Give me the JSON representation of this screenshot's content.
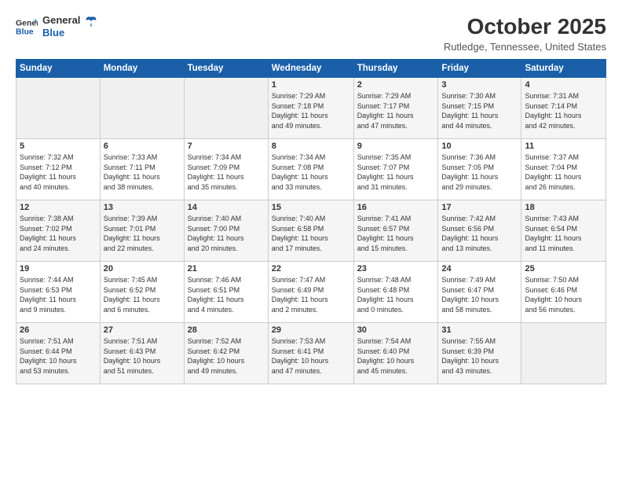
{
  "logo": {
    "line1": "General",
    "line2": "Blue"
  },
  "title": "October 2025",
  "location": "Rutledge, Tennessee, United States",
  "days_of_week": [
    "Sunday",
    "Monday",
    "Tuesday",
    "Wednesday",
    "Thursday",
    "Friday",
    "Saturday"
  ],
  "weeks": [
    [
      {
        "num": "",
        "info": ""
      },
      {
        "num": "",
        "info": ""
      },
      {
        "num": "",
        "info": ""
      },
      {
        "num": "1",
        "info": "Sunrise: 7:29 AM\nSunset: 7:18 PM\nDaylight: 11 hours\nand 49 minutes."
      },
      {
        "num": "2",
        "info": "Sunrise: 7:29 AM\nSunset: 7:17 PM\nDaylight: 11 hours\nand 47 minutes."
      },
      {
        "num": "3",
        "info": "Sunrise: 7:30 AM\nSunset: 7:15 PM\nDaylight: 11 hours\nand 44 minutes."
      },
      {
        "num": "4",
        "info": "Sunrise: 7:31 AM\nSunset: 7:14 PM\nDaylight: 11 hours\nand 42 minutes."
      }
    ],
    [
      {
        "num": "5",
        "info": "Sunrise: 7:32 AM\nSunset: 7:12 PM\nDaylight: 11 hours\nand 40 minutes."
      },
      {
        "num": "6",
        "info": "Sunrise: 7:33 AM\nSunset: 7:11 PM\nDaylight: 11 hours\nand 38 minutes."
      },
      {
        "num": "7",
        "info": "Sunrise: 7:34 AM\nSunset: 7:09 PM\nDaylight: 11 hours\nand 35 minutes."
      },
      {
        "num": "8",
        "info": "Sunrise: 7:34 AM\nSunset: 7:08 PM\nDaylight: 11 hours\nand 33 minutes."
      },
      {
        "num": "9",
        "info": "Sunrise: 7:35 AM\nSunset: 7:07 PM\nDaylight: 11 hours\nand 31 minutes."
      },
      {
        "num": "10",
        "info": "Sunrise: 7:36 AM\nSunset: 7:05 PM\nDaylight: 11 hours\nand 29 minutes."
      },
      {
        "num": "11",
        "info": "Sunrise: 7:37 AM\nSunset: 7:04 PM\nDaylight: 11 hours\nand 26 minutes."
      }
    ],
    [
      {
        "num": "12",
        "info": "Sunrise: 7:38 AM\nSunset: 7:02 PM\nDaylight: 11 hours\nand 24 minutes."
      },
      {
        "num": "13",
        "info": "Sunrise: 7:39 AM\nSunset: 7:01 PM\nDaylight: 11 hours\nand 22 minutes."
      },
      {
        "num": "14",
        "info": "Sunrise: 7:40 AM\nSunset: 7:00 PM\nDaylight: 11 hours\nand 20 minutes."
      },
      {
        "num": "15",
        "info": "Sunrise: 7:40 AM\nSunset: 6:58 PM\nDaylight: 11 hours\nand 17 minutes."
      },
      {
        "num": "16",
        "info": "Sunrise: 7:41 AM\nSunset: 6:57 PM\nDaylight: 11 hours\nand 15 minutes."
      },
      {
        "num": "17",
        "info": "Sunrise: 7:42 AM\nSunset: 6:56 PM\nDaylight: 11 hours\nand 13 minutes."
      },
      {
        "num": "18",
        "info": "Sunrise: 7:43 AM\nSunset: 6:54 PM\nDaylight: 11 hours\nand 11 minutes."
      }
    ],
    [
      {
        "num": "19",
        "info": "Sunrise: 7:44 AM\nSunset: 6:53 PM\nDaylight: 11 hours\nand 9 minutes."
      },
      {
        "num": "20",
        "info": "Sunrise: 7:45 AM\nSunset: 6:52 PM\nDaylight: 11 hours\nand 6 minutes."
      },
      {
        "num": "21",
        "info": "Sunrise: 7:46 AM\nSunset: 6:51 PM\nDaylight: 11 hours\nand 4 minutes."
      },
      {
        "num": "22",
        "info": "Sunrise: 7:47 AM\nSunset: 6:49 PM\nDaylight: 11 hours\nand 2 minutes."
      },
      {
        "num": "23",
        "info": "Sunrise: 7:48 AM\nSunset: 6:48 PM\nDaylight: 11 hours\nand 0 minutes."
      },
      {
        "num": "24",
        "info": "Sunrise: 7:49 AM\nSunset: 6:47 PM\nDaylight: 10 hours\nand 58 minutes."
      },
      {
        "num": "25",
        "info": "Sunrise: 7:50 AM\nSunset: 6:46 PM\nDaylight: 10 hours\nand 56 minutes."
      }
    ],
    [
      {
        "num": "26",
        "info": "Sunrise: 7:51 AM\nSunset: 6:44 PM\nDaylight: 10 hours\nand 53 minutes."
      },
      {
        "num": "27",
        "info": "Sunrise: 7:51 AM\nSunset: 6:43 PM\nDaylight: 10 hours\nand 51 minutes."
      },
      {
        "num": "28",
        "info": "Sunrise: 7:52 AM\nSunset: 6:42 PM\nDaylight: 10 hours\nand 49 minutes."
      },
      {
        "num": "29",
        "info": "Sunrise: 7:53 AM\nSunset: 6:41 PM\nDaylight: 10 hours\nand 47 minutes."
      },
      {
        "num": "30",
        "info": "Sunrise: 7:54 AM\nSunset: 6:40 PM\nDaylight: 10 hours\nand 45 minutes."
      },
      {
        "num": "31",
        "info": "Sunrise: 7:55 AM\nSunset: 6:39 PM\nDaylight: 10 hours\nand 43 minutes."
      },
      {
        "num": "",
        "info": ""
      }
    ]
  ]
}
